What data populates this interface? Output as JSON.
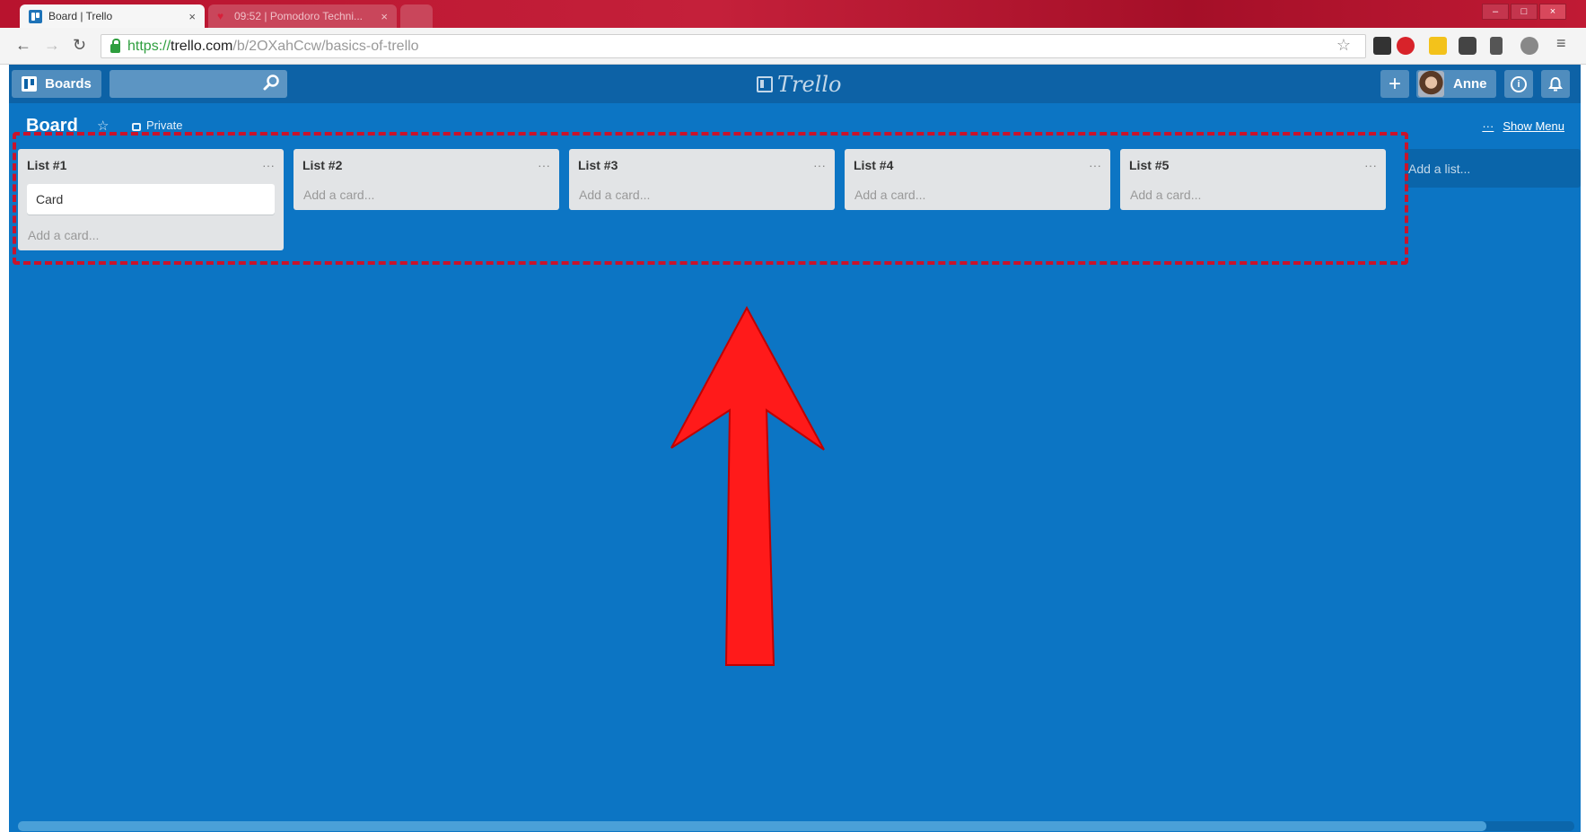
{
  "browser": {
    "tabs": [
      {
        "title": "Board | Trello",
        "close": "×"
      },
      {
        "title": "09:52 | Pomodoro Techni...",
        "close": "×"
      }
    ],
    "url": {
      "scheme": "https://",
      "host": "trello.com",
      "path": "/b/2OXahCcw/basics-of-trello"
    },
    "window_controls": [
      "–",
      "□",
      "×"
    ]
  },
  "trello": {
    "boards_label": "Boards",
    "logo_text": "Trello",
    "user_name": "Anne",
    "plus_label": "+"
  },
  "board": {
    "title": "Board",
    "visibility": "Private",
    "show_menu": "Show Menu",
    "show_menu_dots": "···"
  },
  "lists": [
    {
      "title": "List #1",
      "menu": "···",
      "cards": [
        "Card"
      ],
      "add_card": "Add a card..."
    },
    {
      "title": "List #2",
      "menu": "···",
      "cards": [],
      "add_card": "Add a card..."
    },
    {
      "title": "List #3",
      "menu": "···",
      "cards": [],
      "add_card": "Add a card..."
    },
    {
      "title": "List #4",
      "menu": "···",
      "cards": [],
      "add_card": "Add a card..."
    },
    {
      "title": "List #5",
      "menu": "···",
      "cards": [],
      "add_card": "Add a card..."
    }
  ],
  "add_list": "Add a list...",
  "colors": {
    "board_background": "#0c75c4",
    "header": "#0d62a6",
    "annotation_red": "#c9132b",
    "arrow_red": "#ff1a1a"
  }
}
